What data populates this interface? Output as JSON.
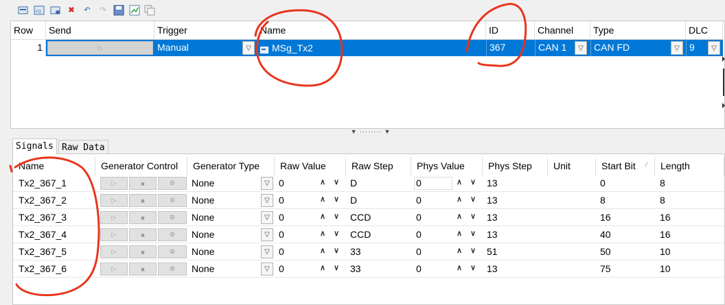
{
  "toolbar": {
    "icons": [
      "new-message-icon",
      "new-fd-message-icon",
      "new-message-alt-icon",
      "delete-icon",
      "undo-icon",
      "redo-icon",
      "save-icon",
      "chart-icon",
      "copy-icon"
    ],
    "delete_color": "#d32f2f"
  },
  "messages": {
    "columns": [
      "Row",
      "Send",
      "Trigger",
      "Name",
      "ID",
      "Channel",
      "Type",
      "DLC"
    ],
    "row": {
      "row": "1",
      "trigger": "Manual",
      "name": "MSg_Tx2",
      "id": "367",
      "channel": "CAN 1",
      "type": "CAN FD",
      "dlc": "9"
    },
    "selection_color": "#0078d7"
  },
  "tabs": [
    {
      "label": "Signals",
      "active": true
    },
    {
      "label": "Raw Data",
      "active": false
    }
  ],
  "signals": {
    "columns": [
      "Name",
      "Generator Control",
      "Generator Type",
      "Raw Value",
      "Raw Step",
      "Phys Value",
      "Phys Step",
      "Unit",
      "Start Bit",
      "Length"
    ],
    "rows": [
      {
        "name": "Tx2_367_1",
        "gen_type": "None",
        "raw_value": "0",
        "raw_step": "D",
        "phys_value": "0",
        "phys_step": "13",
        "unit": "",
        "start_bit": "0",
        "length": "8"
      },
      {
        "name": "Tx2_367_2",
        "gen_type": "None",
        "raw_value": "0",
        "raw_step": "D",
        "phys_value": "0",
        "phys_step": "13",
        "unit": "",
        "start_bit": "8",
        "length": "8"
      },
      {
        "name": "Tx2_367_3",
        "gen_type": "None",
        "raw_value": "0",
        "raw_step": "CCD",
        "phys_value": "0",
        "phys_step": "13",
        "unit": "",
        "start_bit": "16",
        "length": "16"
      },
      {
        "name": "Tx2_367_4",
        "gen_type": "None",
        "raw_value": "0",
        "raw_step": "CCD",
        "phys_value": "0",
        "phys_step": "13",
        "unit": "",
        "start_bit": "40",
        "length": "16"
      },
      {
        "name": "Tx2_367_5",
        "gen_type": "None",
        "raw_value": "0",
        "raw_step": "33",
        "phys_value": "0",
        "phys_step": "51",
        "unit": "",
        "start_bit": "50",
        "length": "10"
      },
      {
        "name": "Tx2_367_6",
        "gen_type": "None",
        "raw_value": "0",
        "raw_step": "33",
        "phys_value": "0",
        "phys_step": "13",
        "unit": "",
        "start_bit": "75",
        "length": "10"
      }
    ]
  },
  "annotation_color": "#e8341c"
}
